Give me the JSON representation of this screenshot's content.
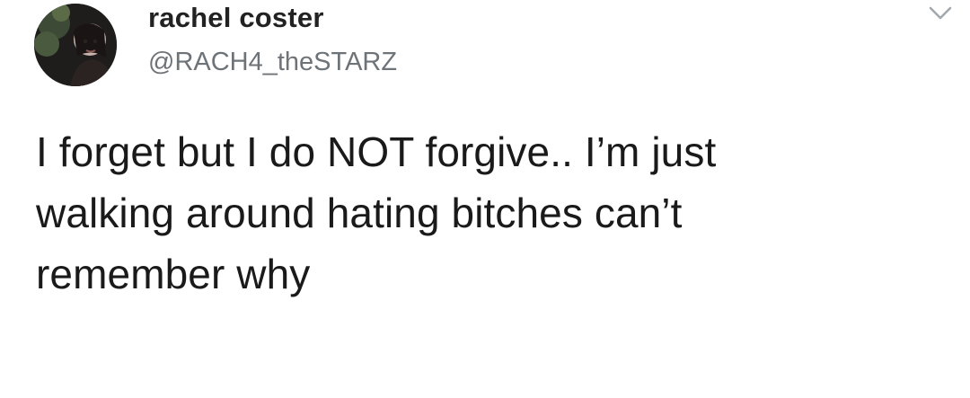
{
  "tweet": {
    "display_name": "rachel coster",
    "handle": "@RACH4_theSTARZ",
    "text_lines": [
      "I forget but I do NOT forgive.. I’m just",
      "walking around hating bitches can’t",
      "remember why"
    ],
    "caret_icon": "chevron-down-icon"
  },
  "colors": {
    "name": "#222222",
    "handle": "#6e7378",
    "text": "#1a1a1a",
    "background": "#ffffff"
  }
}
